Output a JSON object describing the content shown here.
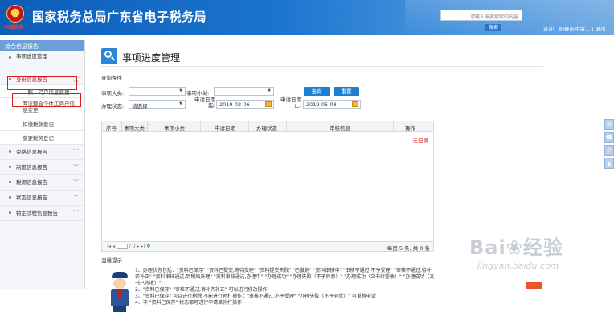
{
  "header": {
    "emblem_caption": "中国税务",
    "site_title": "国家税务总局广东省电子税务局",
    "search_placeholder": "请输入需要搜索的内容",
    "search_button": "搜索",
    "user_greeting": "欢迎，阳春市中审...",
    "logout": "退出"
  },
  "sidebar": {
    "heading": "综合信息报告",
    "items": [
      {
        "label": "事项进度管理"
      },
      {
        "label": "身份信息报告"
      },
      {
        "label": "一照一码户信息变更"
      },
      {
        "label": "两证整合个体工商户信息变更"
      },
      {
        "label": "扣缴税款登记"
      },
      {
        "label": "变更税务登记"
      },
      {
        "label": "资格信息报告"
      },
      {
        "label": "制度信息报告"
      },
      {
        "label": "税源信息报告"
      },
      {
        "label": "状态信息报告"
      },
      {
        "label": "特定涉税信息报告"
      }
    ]
  },
  "main": {
    "title": "事项进度管理",
    "query_section": "查询条件",
    "filters": {
      "major_label": "事项大类:",
      "minor_label": "事项小类:",
      "status_label": "办理状态:",
      "status_value": "请选择",
      "start_label": "申请日期起:",
      "start_value": "2019-02-06",
      "end_label": "申请日期止:",
      "end_value": "2019-05-08"
    },
    "buttons": {
      "query": "查询",
      "reset": "重置"
    },
    "columns": [
      "序号",
      "事项大类",
      "事项小类",
      "申请日期",
      "办理状态",
      "审核信息",
      "操作"
    ],
    "empty_text": "无记录",
    "pager": {
      "page_text": "/ 0 ▸ ▸|",
      "summary": "每页 5 条, 共 0 条"
    },
    "tips": {
      "title": "温馨提示",
      "lines": [
        "1、办理状态包括：\"资料已保存\" \"资料已提交,等待受理\" \"资料提交失败\" \"已撤销\" \"资料审核中\" \"审核不通过,不予受理\" \"审核不通过,待补齐补正\" \"资料审核通过,到税局办理\" \"资料审核通过,办理中\" \"办理成功\" \"办理失败（不予同意）\" \"办理成功（文书待签收）\" \"办理成功（文书已签收）\"",
        "2、\"资料已保存\" \"审核不通过,待补齐补正\" 可以进行修改操作",
        "3、\"资料已保存\" 可以进行删除,不能进行补打操作；\"审核不通过,不予受理\" \"办理失败（不予同意）\" 可重新申请",
        "4、非 \"资料已保存\" 状态都可进行申请单补打操作"
      ]
    }
  },
  "watermark": {
    "logo": "Bai❀经验",
    "url": "jingyan.baidu.com"
  },
  "colors": {
    "header_blue": "#1b74cf",
    "accent_blue": "#1f7fd0",
    "highlight_red": "#e01b1b",
    "empty_red": "#e02020"
  }
}
